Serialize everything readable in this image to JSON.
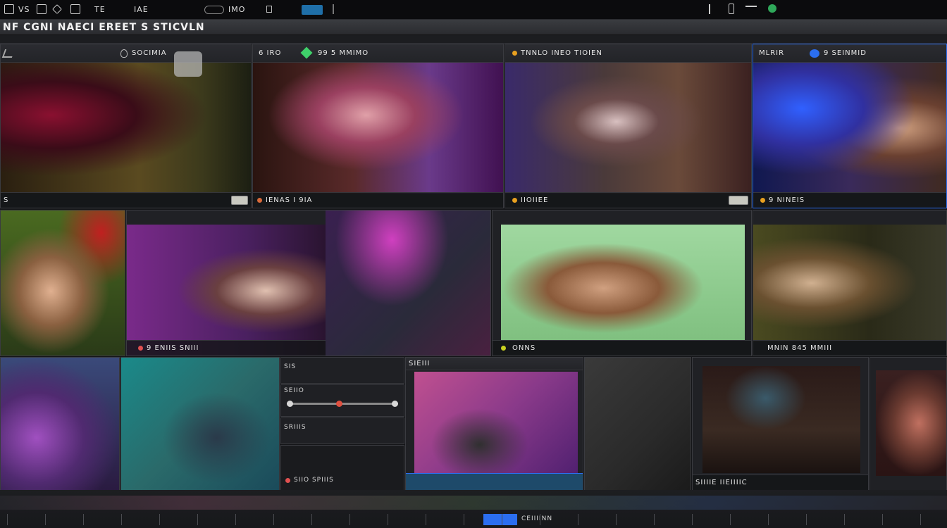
{
  "menubar": {
    "items": [
      "VS",
      "TE",
      "IAE",
      "IMO"
    ],
    "right_icons": [
      "flag-icon",
      "phone-icon",
      "gear-icon"
    ]
  },
  "title": "NF CGNI NAECI EREET S STICVLN",
  "top_row": [
    {
      "label": "SOCIMIA",
      "footer": "S",
      "dot": "#6cc04a"
    },
    {
      "label": "6 IRO",
      "label2": "99 5 MMIMO",
      "footer": "IENAS I 9IA",
      "dot": "#d86a3a"
    },
    {
      "label": "TNNLO INEO TIOIEN",
      "footer": "IIOIIEE",
      "dot": "#e8a020"
    },
    {
      "label": "MLRIR",
      "label2": "9 SEINMID",
      "footer": "9 NINEIS",
      "dot": "#e8a020"
    }
  ],
  "mid_row": [
    {
      "footer": "9 ENIIS SNIII"
    },
    {
      "footer": "ONNS"
    },
    {
      "footer": "MNIN   845 MMIII"
    }
  ],
  "controls": {
    "label1": "SIS",
    "label2": "SEIIO",
    "label3": "SRIIIS",
    "footer": "SIIO SPIIIS"
  },
  "bottom_row": [
    {
      "label": "SIEIII"
    },
    {
      "footer": "SIIIIE  IIEIIIIC"
    }
  ],
  "timeline": {
    "label": "CEIIIINN"
  },
  "colors": {
    "accent_green": "#3fd06a",
    "accent_blue": "#2b6ef0",
    "accent_orange": "#e8a020"
  }
}
